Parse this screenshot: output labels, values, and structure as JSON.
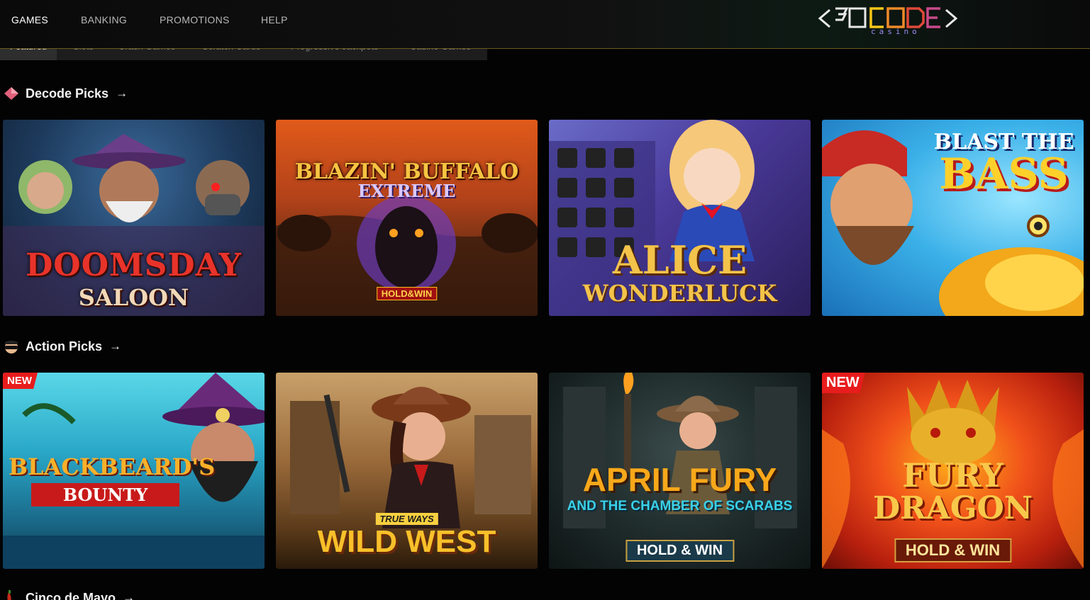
{
  "nav": {
    "items": [
      "GAMES",
      "BANKING",
      "PROMOTIONS",
      "HELP"
    ],
    "active": "GAMES",
    "logo_text": "DECODE",
    "logo_tag": "casino"
  },
  "subtabs": [
    "Featured",
    "Slots",
    "Crash Games",
    "Scratch Cards",
    "Progressive Jackpots",
    "Casino Games"
  ],
  "sections": [
    {
      "title": "Decode Picks",
      "icon": "diamond-icon",
      "games": [
        {
          "title_line1": "DOOMSDAY",
          "title_line2": "SALOON",
          "badge": ""
        },
        {
          "title_line1": "BLAZIN' BUFFALO",
          "title_line2": "EXTREME",
          "extra": "HOLD&WIN",
          "badge": ""
        },
        {
          "title_line1": "ALICE",
          "title_line2": "WONDERLUCK",
          "badge": ""
        },
        {
          "title_line1": "BLAST THE",
          "title_line2": "BASS",
          "badge": ""
        }
      ]
    },
    {
      "title": "Action Picks",
      "icon": "bandit-mask-icon",
      "games": [
        {
          "title_line1": "BLACKBEARD'S",
          "title_line2": "BOUNTY",
          "badge": "NEW"
        },
        {
          "title_line1": "TRUE WAYS",
          "title_line2": "WILD WEST",
          "badge": ""
        },
        {
          "title_line1": "APRIL FURY",
          "title_line2": "AND THE CHAMBER OF SCARABS",
          "extra": "HOLD & WIN",
          "badge": ""
        },
        {
          "title_line1": "FURY",
          "title_line2": "DRAGON",
          "extra": "HOLD & WIN",
          "badge": "NEW"
        }
      ]
    },
    {
      "title": "Cinco de Mayo",
      "icon": "chili-icon"
    }
  ]
}
